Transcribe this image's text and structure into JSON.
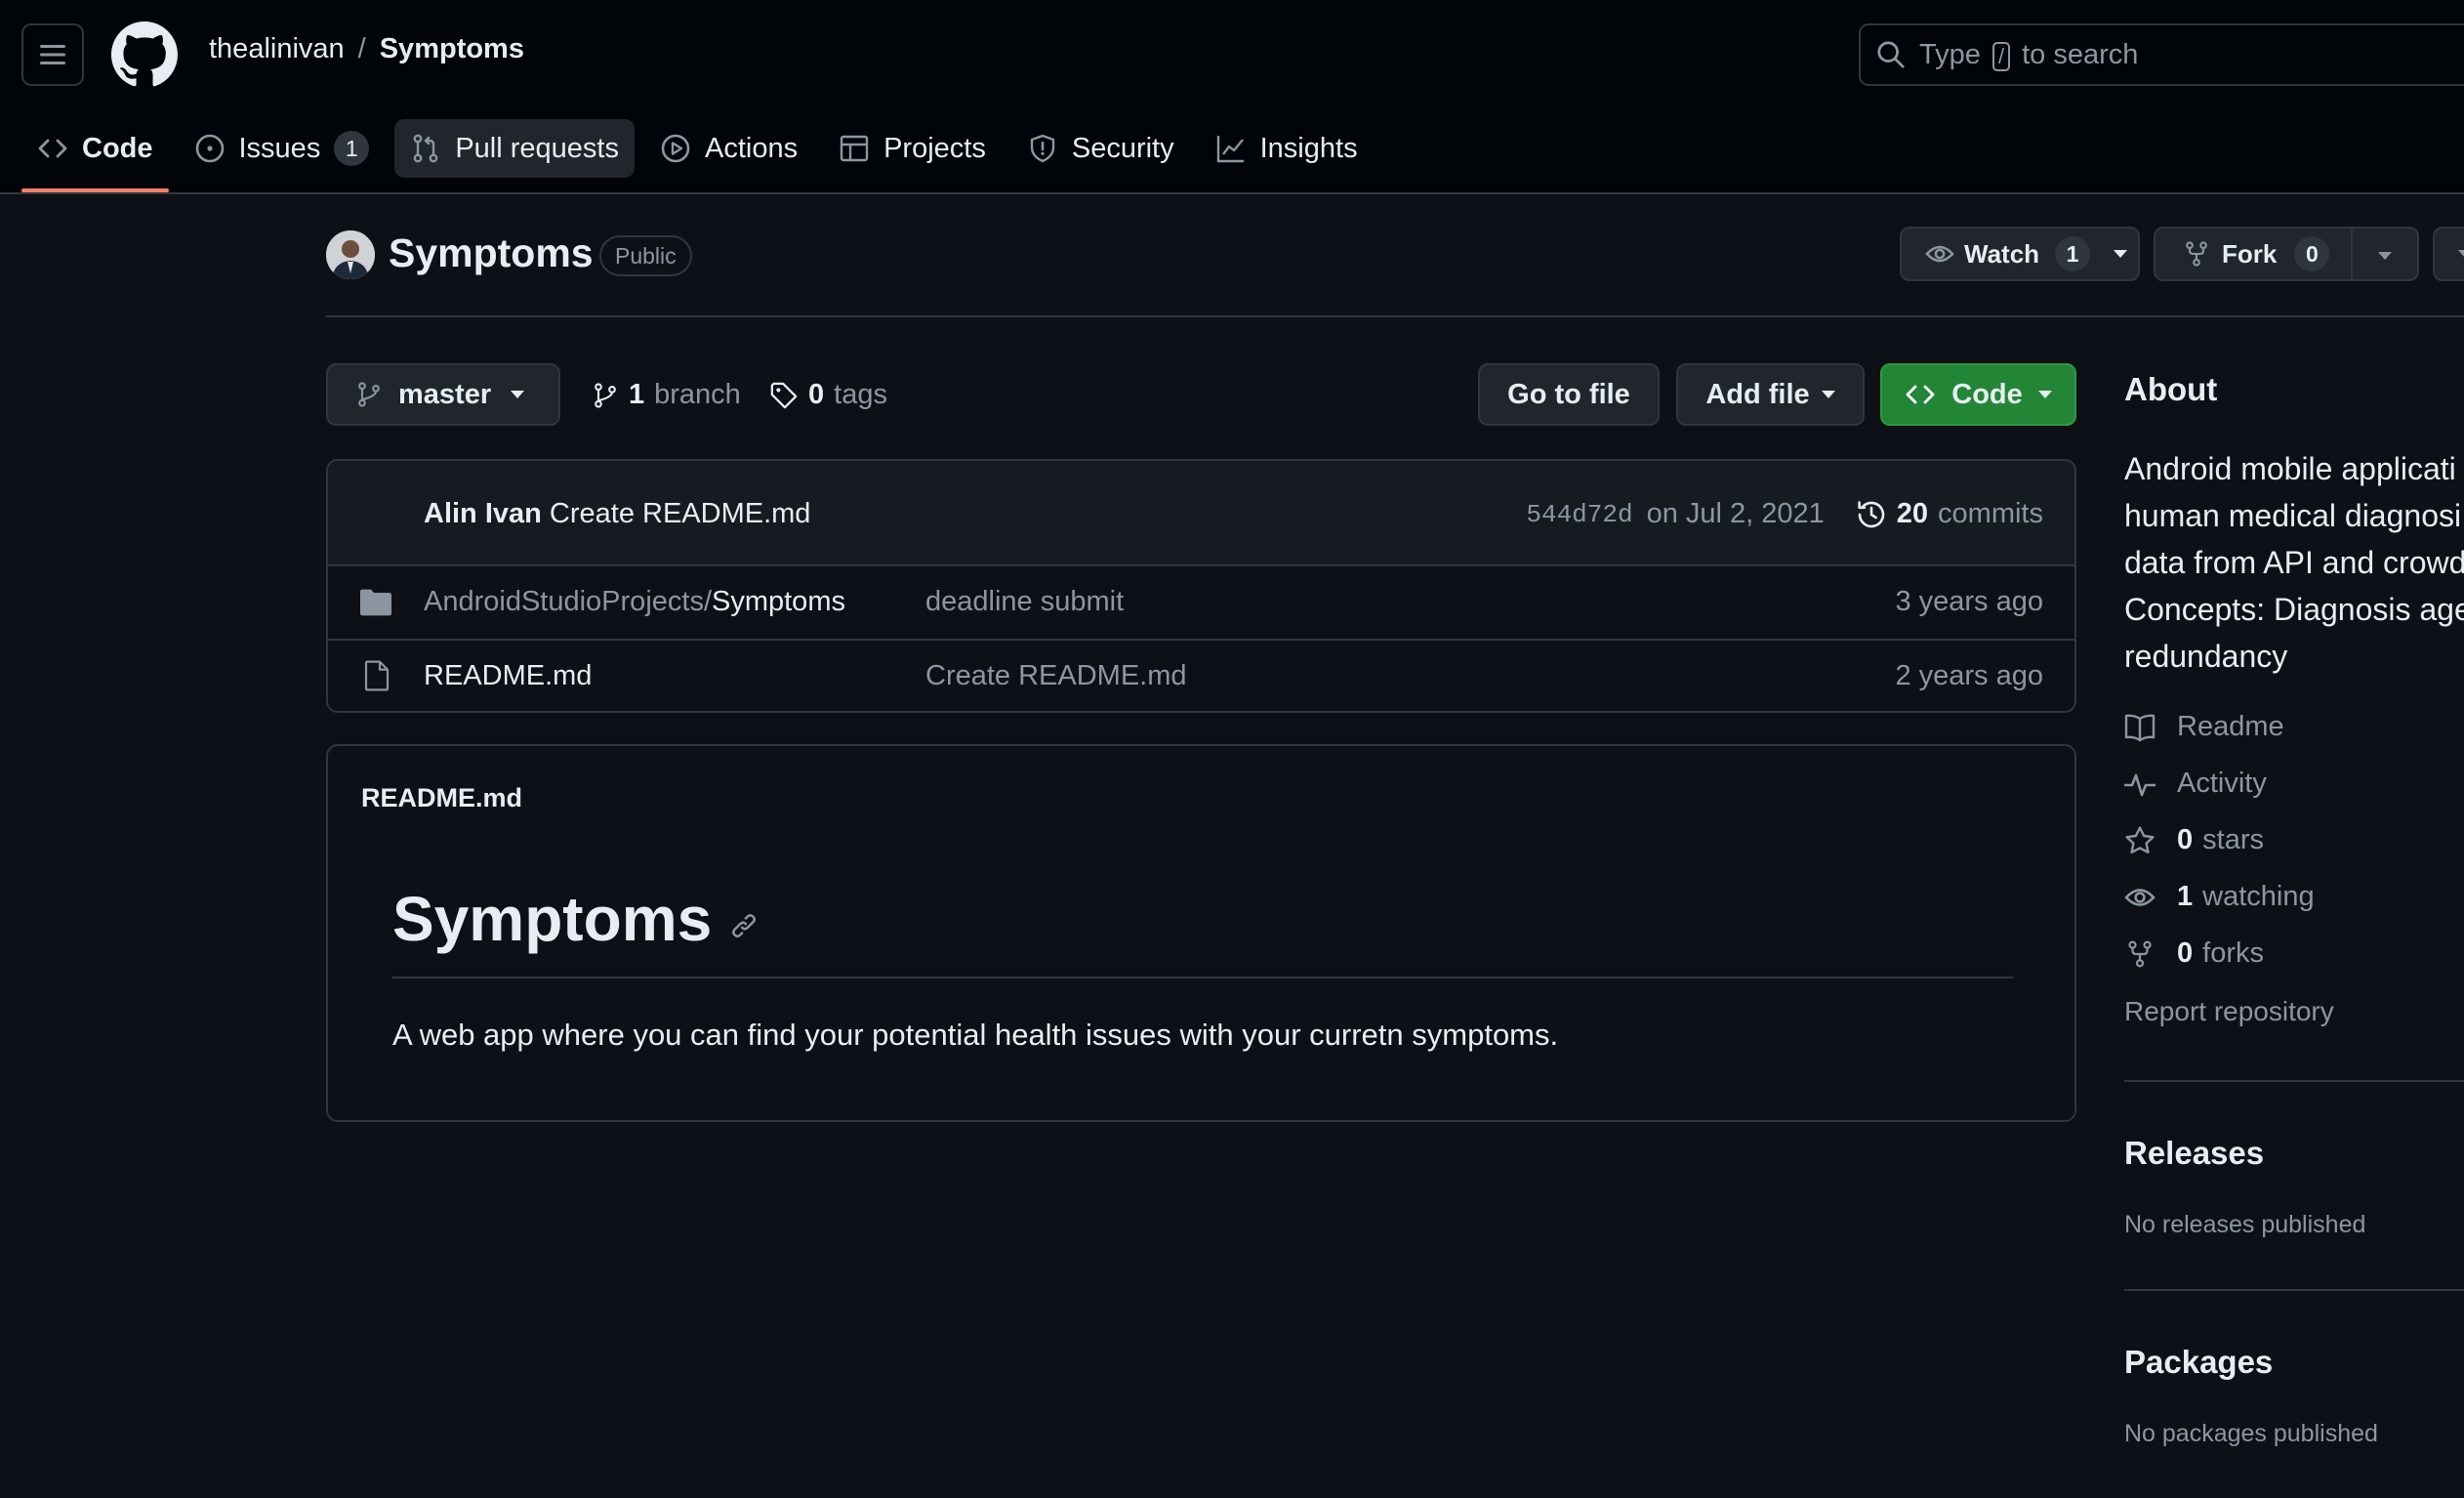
{
  "header": {
    "owner": "thealinivan",
    "separator": "/",
    "repo": "Symptoms",
    "search": {
      "prefix": "Type",
      "key": "/",
      "suffix": "to search"
    }
  },
  "tabs": [
    {
      "label": "Code",
      "icon": "code-icon",
      "selected": true
    },
    {
      "label": "Issues",
      "icon": "issue-opened-icon",
      "count": "1"
    },
    {
      "label": "Pull requests",
      "icon": "git-pull-request-icon"
    },
    {
      "label": "Actions",
      "icon": "play-icon"
    },
    {
      "label": "Projects",
      "icon": "table-icon"
    },
    {
      "label": "Security",
      "icon": "shield-icon"
    },
    {
      "label": "Insights",
      "icon": "graph-icon"
    }
  ],
  "repo": {
    "name": "Symptoms",
    "visibility": "Public",
    "watch": {
      "label": "Watch",
      "count": "1"
    },
    "fork": {
      "label": "Fork",
      "count": "0"
    }
  },
  "toolbar": {
    "branch": "master",
    "branches": {
      "count": "1",
      "label": "branch"
    },
    "tags": {
      "count": "0",
      "label": "tags"
    },
    "go_to_file": "Go to file",
    "add_file": "Add file",
    "code": "Code"
  },
  "commit": {
    "author": "Alin Ivan",
    "message": "Create README.md",
    "sha": "544d72d",
    "date": "on Jul 2, 2021",
    "commits_count": "20",
    "commits_label": "commits"
  },
  "files": [
    {
      "type": "folder",
      "icon": "folder-icon",
      "path_prefix": "AndroidStudioProjects/",
      "name": "Symptoms",
      "message": "deadline submit",
      "age": "3 years ago"
    },
    {
      "type": "file",
      "icon": "file-icon",
      "path_prefix": "",
      "name": "README.md",
      "message": "Create README.md",
      "age": "2 years ago"
    }
  ],
  "readme": {
    "filename": "README.md",
    "heading": "Symptoms",
    "body": "A web app where you can find your potential health issues with your curretn symptoms."
  },
  "about": {
    "title": "About",
    "description_lines": [
      "Android mobile applicati",
      "human medical diagnosi",
      "data from API and crowd",
      "Concepts: Diagnosis age",
      "redundancy"
    ],
    "links": [
      {
        "icon": "book-icon",
        "num": "",
        "label": "Readme"
      },
      {
        "icon": "pulse-icon",
        "num": "",
        "label": "Activity"
      },
      {
        "icon": "star-icon",
        "num": "0",
        "label": "stars"
      },
      {
        "icon": "eye-icon",
        "num": "1",
        "label": "watching"
      },
      {
        "icon": "repo-forked-icon",
        "num": "0",
        "label": "forks"
      }
    ],
    "report": "Report repository"
  },
  "releases": {
    "title": "Releases",
    "empty": "No releases published"
  },
  "packages": {
    "title": "Packages",
    "empty": "No packages published"
  },
  "colors": {
    "background": "#0d1117",
    "header": "#010409",
    "border": "#30363d",
    "accent_tab": "#f78166",
    "green_button": "#238636",
    "muted_text": "#8d96a0"
  }
}
